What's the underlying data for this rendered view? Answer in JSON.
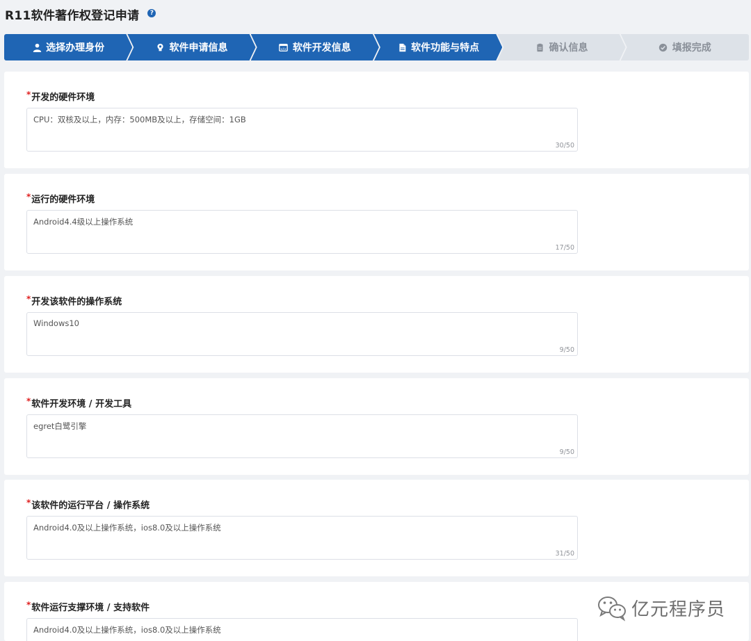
{
  "header": {
    "title": "R11软件著作权登记申请",
    "help_icon": "question-circle-icon"
  },
  "steps": [
    {
      "label": "选择办理身份",
      "icon": "user-icon",
      "state": "active"
    },
    {
      "label": "软件申请信息",
      "icon": "lightbulb-icon",
      "state": "active"
    },
    {
      "label": "软件开发信息",
      "icon": "code-window-icon",
      "state": "active"
    },
    {
      "label": "软件功能与特点",
      "icon": "document-icon",
      "state": "active"
    },
    {
      "label": "确认信息",
      "icon": "clipboard-icon",
      "state": "inactive"
    },
    {
      "label": "填报完成",
      "icon": "check-circle-icon",
      "state": "inactive"
    }
  ],
  "fields": [
    {
      "label": "开发的硬件环境",
      "required": "*",
      "value": "CPU：双核及以上，内存：500MB及以上，存储空间：1GB",
      "counter": "30/50"
    },
    {
      "label": "运行的硬件环境",
      "required": "*",
      "value": "Android4.4级以上操作系统",
      "counter": "17/50"
    },
    {
      "label": "开发该软件的操作系统",
      "required": "*",
      "value": "Windows10",
      "counter": "9/50"
    },
    {
      "label": "软件开发环境 / 开发工具",
      "required": "*",
      "value": "egret白鹭引擎",
      "counter": "9/50"
    },
    {
      "label": "该软件的运行平台 / 操作系统",
      "required": "*",
      "value": "Android4.0及以上操作系统，ios8.0及以上操作系统",
      "counter": "31/50"
    },
    {
      "label": "软件运行支撑环境 / 支持软件",
      "required": "*",
      "value": "Android4.0及以上操作系统，ios8.0及以上操作系统",
      "counter": ""
    }
  ],
  "watermark": {
    "text": "亿元程序员",
    "icon": "wechat-logo-icon"
  },
  "colors": {
    "accent": "#1f65b4",
    "inactive_step": "#dde2e8",
    "required": "#e02020",
    "background": "#f0f2f5"
  }
}
